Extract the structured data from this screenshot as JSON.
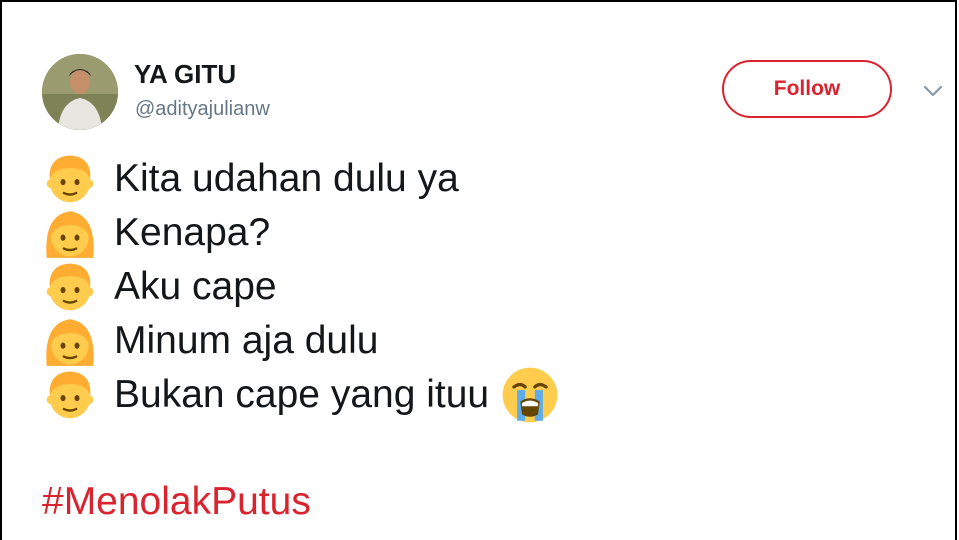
{
  "tweet": {
    "author": {
      "name": "YA GITU",
      "handle": "@adityajulianw"
    },
    "follow_label": "Follow",
    "lines": [
      {
        "speaker_icon": "boy-face-icon",
        "text": "Kita udahan dulu ya"
      },
      {
        "speaker_icon": "girl-face-icon",
        "text": "Kenapa?"
      },
      {
        "speaker_icon": "boy-face-icon",
        "text": "Aku cape"
      },
      {
        "speaker_icon": "girl-face-icon",
        "text": "Minum aja dulu"
      },
      {
        "speaker_icon": "boy-face-icon",
        "text": "Bukan cape yang ituu",
        "trailing_icon": "loudly-crying-face-icon"
      }
    ],
    "hashtag": "#MenolakPutus"
  },
  "colors": {
    "accent": "#d9232e",
    "text": "#14171a",
    "muted": "#657786",
    "emoji_yellow": "#ffcc4d",
    "emoji_hair": "#ffac33"
  }
}
